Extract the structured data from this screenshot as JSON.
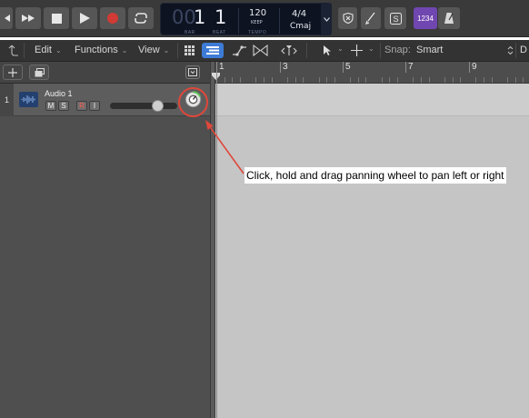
{
  "transport": {
    "rewind_icon": "rewind-icon",
    "forward_icon": "fast-forward-icon",
    "stop_icon": "stop-icon",
    "play_icon": "play-icon",
    "record_icon": "record-icon",
    "cycle_icon": "cycle-icon"
  },
  "lcd": {
    "bar_dim": "00",
    "bar_value": "1",
    "bar_label": "BAR",
    "beat_value": "1",
    "beat_label": "BEAT",
    "tempo_value": "120",
    "keep_label": "KEEP",
    "tempo_label": "TEMPO",
    "time_signature": "4/4",
    "key": "Cmaj"
  },
  "right_controls": {
    "count_in": "1234"
  },
  "toolbar": {
    "edit": "Edit",
    "functions": "Functions",
    "view": "View",
    "snap_label": "Snap:",
    "snap_value": "Smart",
    "truncated": "D"
  },
  "track": {
    "number": "1",
    "name": "Audio 1",
    "mute": "M",
    "solo": "S",
    "record": "R",
    "input": "I"
  },
  "ruler": {
    "bars": [
      "1",
      "3",
      "5",
      "7",
      "9"
    ]
  },
  "annotation": {
    "text": "Click, hold and drag panning wheel to pan left or right"
  },
  "colors": {
    "record_red": "#d23a35",
    "annotation_red": "#e0473a",
    "count_in_purple": "#7046b0",
    "accent_blue": "#3d7bd6",
    "lcd_bg": "#0d1320"
  }
}
